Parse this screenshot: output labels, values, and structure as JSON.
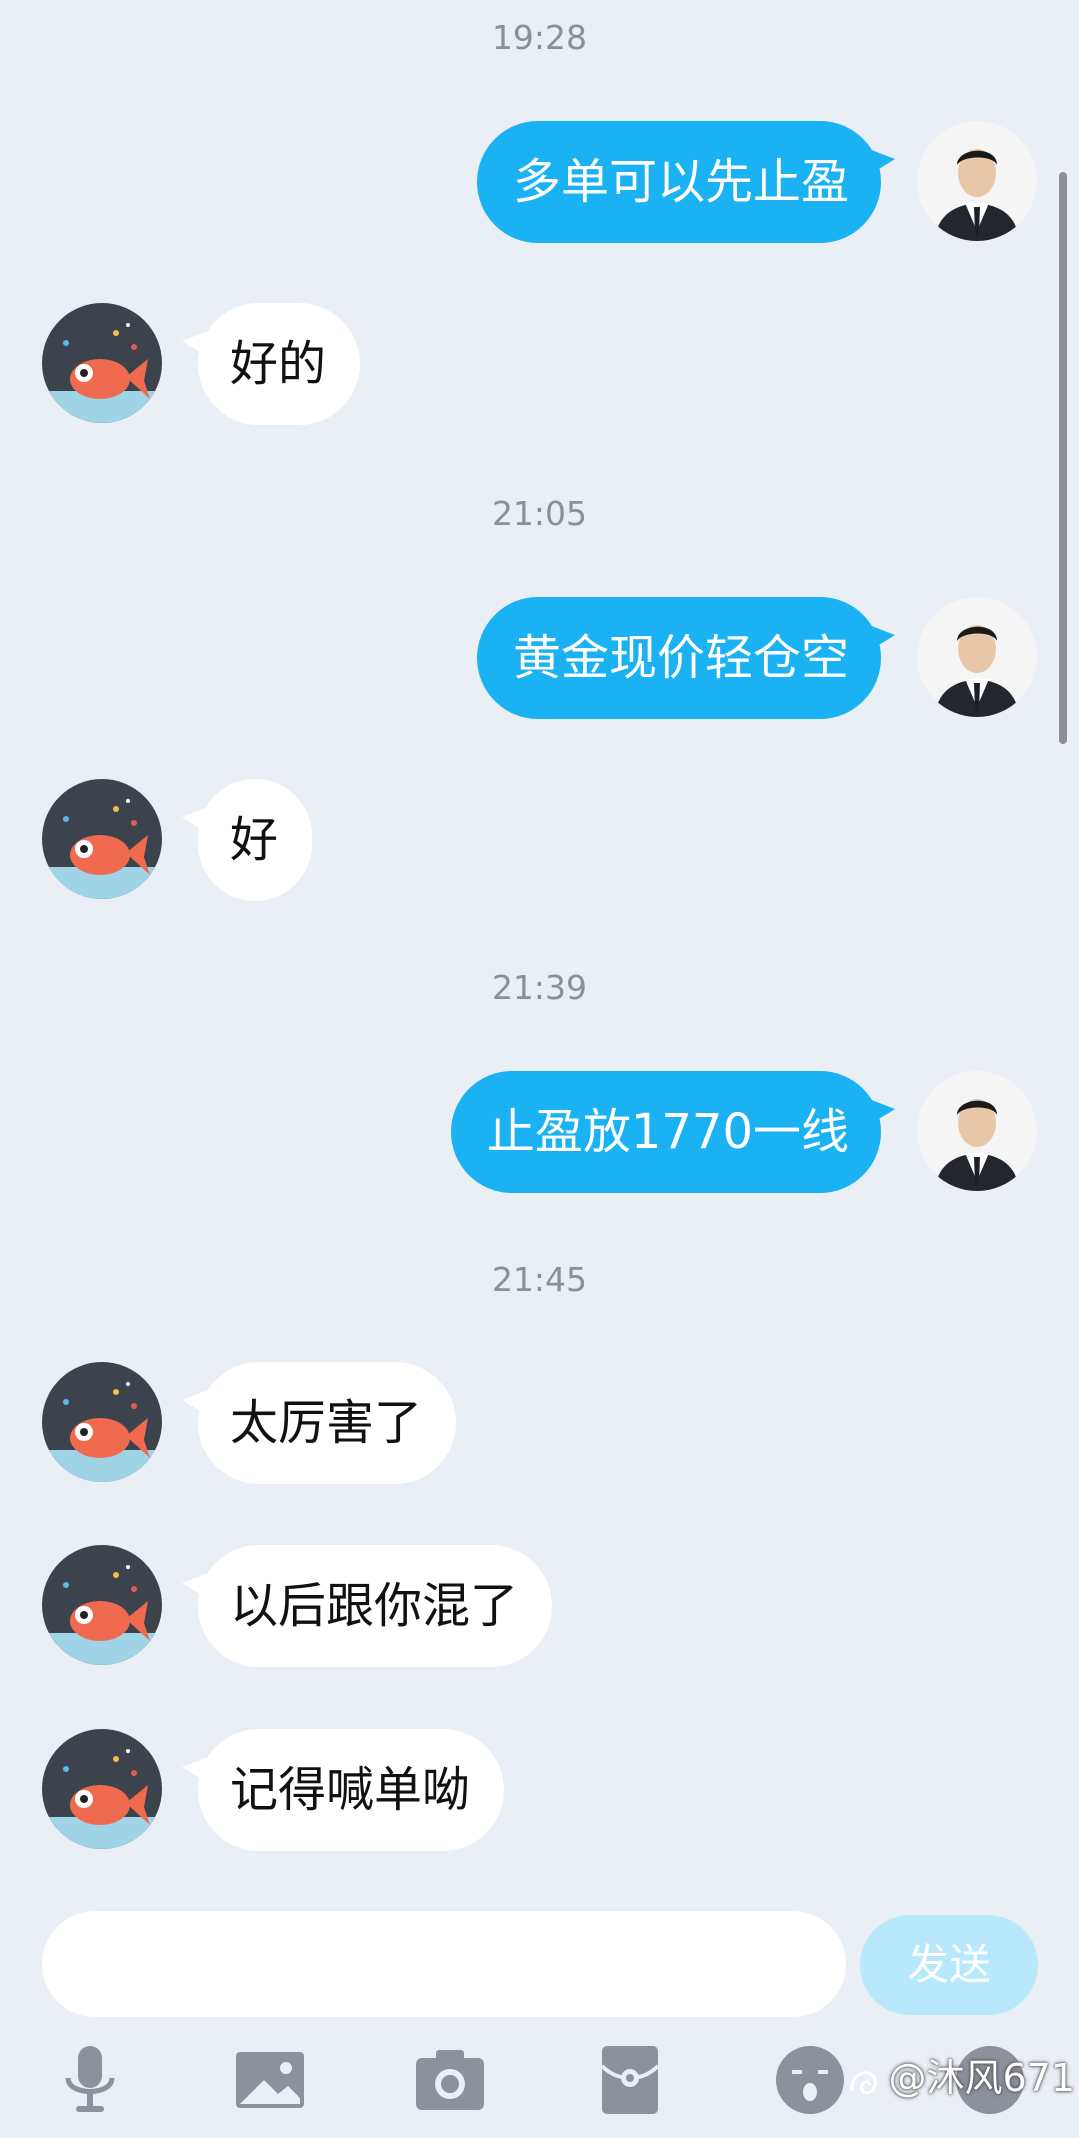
{
  "messages": [
    {
      "type": "timestamp",
      "text": "19:28"
    },
    {
      "type": "outgoing",
      "text": "多单可以先止盈"
    },
    {
      "type": "incoming",
      "text": "好的"
    },
    {
      "type": "timestamp",
      "text": "21:05"
    },
    {
      "type": "outgoing",
      "text": "黄金现价轻仓空"
    },
    {
      "type": "incoming",
      "text": "好"
    },
    {
      "type": "timestamp",
      "text": "21:39"
    },
    {
      "type": "outgoing",
      "text": "止盈放1770一线"
    },
    {
      "type": "timestamp",
      "text": "21:45"
    },
    {
      "type": "incoming",
      "text": "太厉害了"
    },
    {
      "type": "incoming",
      "text": "以后跟你混了"
    },
    {
      "type": "incoming",
      "text": "记得喊单呦"
    }
  ],
  "composer": {
    "input_value": "",
    "send_label": "发送"
  },
  "toolbar": {
    "icons": [
      "microphone-icon",
      "image-icon",
      "camera-icon",
      "red-packet-icon",
      "emoji-icon",
      "more-icon"
    ]
  },
  "watermark": {
    "text": "@沐风671"
  },
  "colors": {
    "background": "#eaeef5",
    "outgoing_bubble": "#1ab2f3",
    "incoming_bubble": "#ffffff",
    "send_button": "#b8e8fb",
    "toolbar_icon": "#8d919c"
  }
}
